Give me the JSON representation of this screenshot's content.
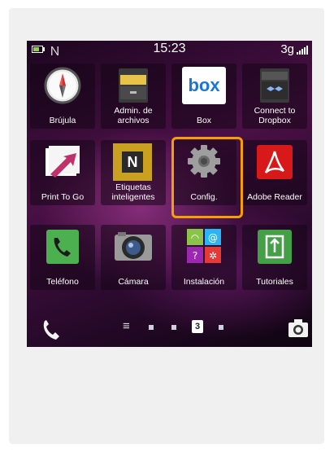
{
  "status_bar": {
    "time": "15:23",
    "network": "3g",
    "battery_icon": "battery-icon",
    "nfc_icon": "nfc-icon",
    "signal_icon": "signal-bars-icon"
  },
  "apps": [
    {
      "label": "Brújula",
      "icon": "compass-icon"
    },
    {
      "label": "Admin. de archivos",
      "icon": "file-manager-icon"
    },
    {
      "label": "Box",
      "icon": "box-icon",
      "logo_text": "box"
    },
    {
      "label": "Connect to Dropbox",
      "icon": "dropbox-icon"
    },
    {
      "label": "Print To Go",
      "icon": "print-to-go-icon"
    },
    {
      "label": "Etiquetas inteligentes",
      "icon": "smart-tags-icon",
      "logo_text": "N"
    },
    {
      "label": "Config.",
      "icon": "settings-gear-icon"
    },
    {
      "label": "Adobe Reader",
      "icon": "adobe-reader-icon"
    },
    {
      "label": "Teléfono",
      "icon": "phone-icon"
    },
    {
      "label": "Cámara",
      "icon": "camera-icon"
    },
    {
      "label": "Instalación",
      "icon": "setup-icon"
    },
    {
      "label": "Tutoriales",
      "icon": "tutorials-icon"
    }
  ],
  "page_indicator": {
    "menu_icon": "≡",
    "current_page": "3"
  },
  "colors": {
    "highlight": "#f5a000",
    "box_blue": "#1a76d2",
    "adobe_red": "#d8191a",
    "phone_green": "#4caf50"
  }
}
